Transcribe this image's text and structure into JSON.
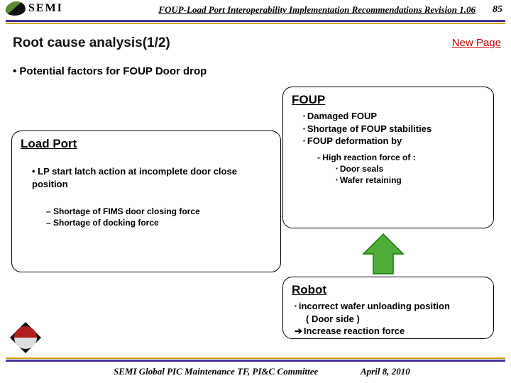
{
  "header": {
    "logo_text": "semi",
    "doc_title": "FOUP-Load Port Interoperability Implementation Recommendations Revision 1.06",
    "page_number": "85"
  },
  "title": "Root cause analysis(1/2)",
  "new_page_label": "New Page",
  "main_bullet": "• Potential factors for FOUP Door drop",
  "foup": {
    "heading": "FOUP",
    "item1": "Damaged FOUP",
    "item2": "Shortage of FOUP stabilities",
    "item3": "FOUP deformation by",
    "sub1": "High reaction force of :",
    "sub1a": "Door seals",
    "sub1b": "Wafer retaining"
  },
  "lp": {
    "heading": "Load Port",
    "item1": "LP start latch action at incomplete door close position",
    "sub1": "Shortage of FIMS door closing force",
    "sub2": "Shortage of docking force"
  },
  "robot": {
    "heading": "Robot",
    "line1": "incorrect wafer unloading position",
    "line1b": "( Door side )",
    "line2": "Increase reaction force"
  },
  "footer": {
    "left": "SEMI Global PIC Maintenance TF, PI&C Committee",
    "right": "April 8, 2010"
  }
}
